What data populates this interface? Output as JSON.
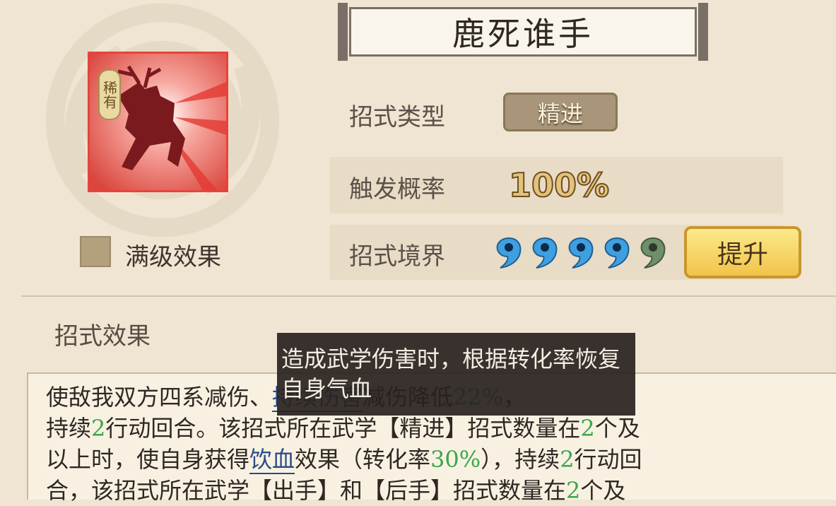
{
  "skill": {
    "title": "鹿死谁手",
    "rarity_badge": "稀有",
    "icon": "leaping-stag-icon"
  },
  "max_level_effect": {
    "checked": false,
    "label": "满级效果"
  },
  "attributes": {
    "type_label": "招式类型",
    "type_value": "精进",
    "trigger_label": "触发概率",
    "trigger_value": "100%",
    "realm_label": "招式境界",
    "realm_total": 5,
    "realm_filled": 4,
    "upgrade_button": "提升"
  },
  "effect_section": {
    "title": "招式效果",
    "lines": [
      [
        "使敌我双方四系减伤、",
        {
          "kw": "持续伤害"
        },
        "减伤降低",
        {
          "num": "22%"
        },
        "，"
      ],
      [
        "持续",
        {
          "num": "2"
        },
        "行动回合。该招式所在武学【精进】招式数量在",
        {
          "num": "2"
        },
        "个及"
      ],
      [
        "以上时，使自身获得",
        {
          "kw": "饮血"
        },
        "效果（转化率",
        {
          "num": "30%"
        },
        "），持续",
        {
          "num": "2"
        },
        "行动回"
      ],
      [
        "合，该招式所在武学【出手】和【后手】招式数量在",
        {
          "num": "2"
        },
        "个及"
      ]
    ]
  },
  "tooltip": {
    "text": "造成武学伤害时，根据转化率恢复自身气血"
  },
  "colors": {
    "background": "#efe5d2",
    "keyword": "#2b4a86",
    "number": "#3aa74a",
    "card_border": "#e8433a",
    "orb_filled": "#3f9fe0",
    "orb_empty": "#6f8f6a"
  }
}
